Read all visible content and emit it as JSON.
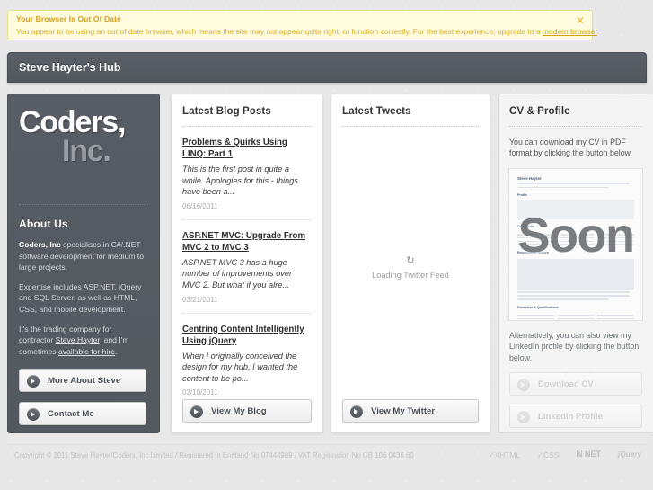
{
  "banner": {
    "title": "Your Browser Is Out Of Date",
    "text_before": "You appear to be using an out of date browser, which means the site may not appear quite right, or function correctly. For the best experience, upgrade to a ",
    "link": "modern browser",
    "text_after": ".",
    "close_icon": "close-icon",
    "close_label": "✕",
    "bg_color": "#fefbdf",
    "text_color": "#d9ae27"
  },
  "header": {
    "title": "Steve Hayter's Hub",
    "bg_color": "#565b62"
  },
  "sidebar": {
    "logo_line1": "Coders,",
    "logo_line2": "Inc.",
    "about_title": "About Us",
    "about_p1_bold": "Coders, Inc",
    "about_p1_rest": " specialises in C#/.NET software development for medium to large projects.",
    "about_p2": "Expertise includes ASP.NET, jQuery and SQL Server, as well as HTML, CSS, and mobile development.",
    "about_p3_before": "It's the trading company for contractor ",
    "about_p3_link1": "Steve Hayter",
    "about_p3_mid": ", and I'm sometimes ",
    "about_p3_link2": "available for hire",
    "about_p3_after": ".",
    "buttons": [
      {
        "label": "More About Steve",
        "icon": "arrow-circle-icon"
      },
      {
        "label": "Contact Me",
        "icon": "arrow-circle-icon"
      }
    ]
  },
  "blog": {
    "title": "Latest Blog Posts",
    "posts": [
      {
        "title": "Problems & Quirks Using LINQ: Part 1",
        "excerpt": "This is the first post in quite a while. Apologies for this - things have been a...",
        "date": "06/16/2011"
      },
      {
        "title": "ASP.NET MVC: Upgrade From MVC 2 to MVC 3",
        "excerpt": "ASP.NET MVC 3 has a huge number of improvements over MVC 2. But what if you alre...",
        "date": "03/21/2011"
      },
      {
        "title": "Centring Content Intelligently Using jQuery",
        "excerpt": "When I originally conceived the design for my hub, I wanted the content to be po...",
        "date": "03/10/2011"
      }
    ],
    "button": {
      "label": "View My Blog",
      "icon": "arrow-circle-icon"
    }
  },
  "tweets": {
    "title": "Latest Tweets",
    "loading_icon": "refresh-icon",
    "loading_glyph": "↻",
    "loading_label": "Loading Twitter Feed",
    "button": {
      "label": "View My Twitter",
      "icon": "arrow-circle-icon"
    }
  },
  "cv": {
    "title": "CV & Profile",
    "text1": "You can download my CV in PDF format by clicking the button below.",
    "overlay_label": "Soon",
    "preview_name": "Steve Hayter",
    "preview_sections": [
      "Profile",
      "Core Skills",
      "Employment History",
      "Education & Qualifications"
    ],
    "text2": "Alternatively, you can also view my LinkedIn profile by clicking the button below.",
    "buttons": [
      {
        "label": "Download CV",
        "icon": "arrow-circle-icon",
        "disabled": true
      },
      {
        "label": "LinkedIn Profile",
        "icon": "arrow-circle-icon",
        "disabled": true
      }
    ]
  },
  "footer": {
    "copyright": "Copyright © 2011 Steve Hayter/Coders, Inc Limited / Registered In England No 07444989 / VAT Registration No GB 106 0435 60",
    "badges": [
      {
        "name": "xhtml-badge",
        "label": "✓XHTML"
      },
      {
        "name": "css-badge",
        "label": "✓CSS"
      },
      {
        "name": "dotnet-badge",
        "label": "ℕ ̅N̅E̅T̅"
      },
      {
        "name": "jquery-badge",
        "label": "jQuery"
      }
    ]
  }
}
